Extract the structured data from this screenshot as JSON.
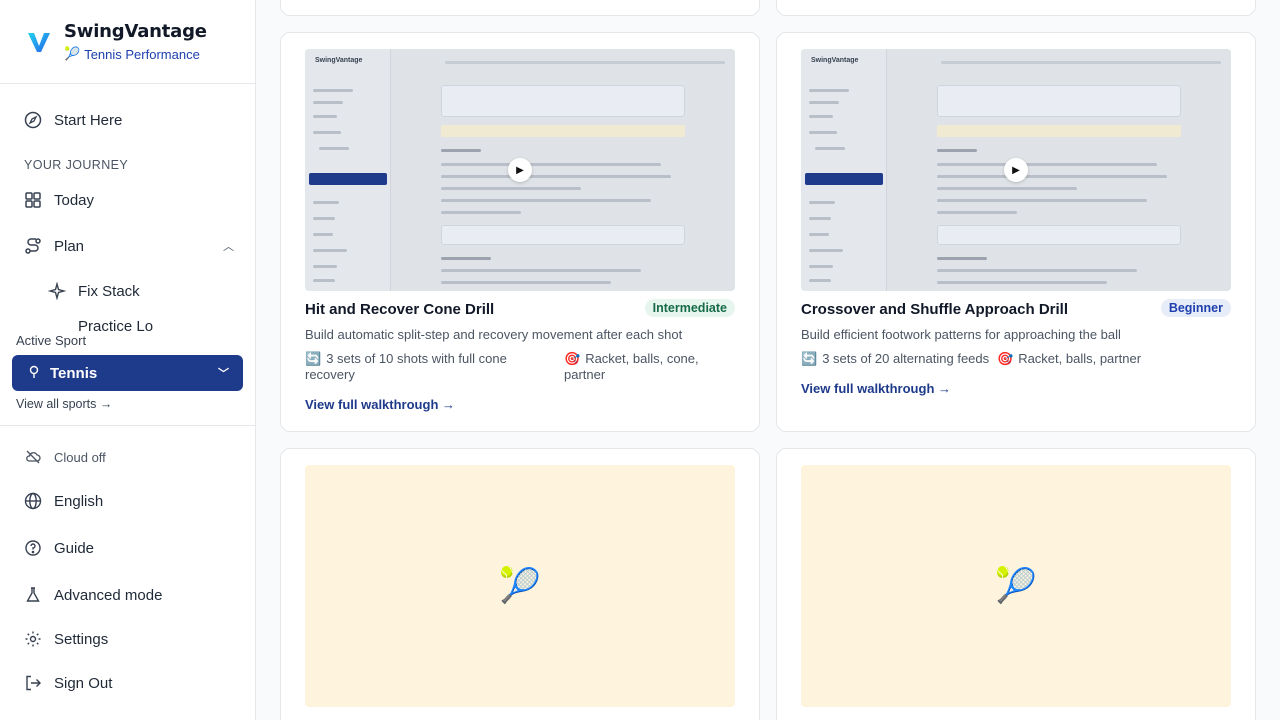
{
  "brand": {
    "name": "SwingVantage",
    "subtitle": "Tennis Performance",
    "subtitle_icon": "🎾"
  },
  "sidebar": {
    "start_here": "Start Here",
    "journey_label": "YOUR JOURNEY",
    "today": "Today",
    "plan": "Plan",
    "fix_stack": "Fix Stack",
    "practice_partial": "Practice Lo",
    "active_sport_label": "Active Sport",
    "sport": "Tennis",
    "view_all": "View all sports →",
    "cloud": "Cloud off",
    "language": "English",
    "guide": "Guide",
    "advanced": "Advanced mode",
    "settings": "Settings",
    "sign_out": "Sign Out"
  },
  "drills": [
    {
      "title": "Hit and Recover Cone Drill",
      "level": "Intermediate",
      "description": "Build automatic split-step and recovery movement after each shot",
      "sets_icon": "🔄",
      "sets": "3 sets of 10 shots with full cone recovery",
      "equip_icon": "🎯",
      "equipment": "Racket, balls, cone, partner",
      "link": "View full walkthrough →",
      "thumb_title": "SwingVantage"
    },
    {
      "title": "Crossover and Shuffle Approach Drill",
      "level": "Beginner",
      "description": "Build efficient footwork patterns for approaching the ball",
      "sets_icon": "🔄",
      "sets": "3 sets of 20 alternating feeds",
      "equip_icon": "🎯",
      "equipment": "Racket, balls, partner",
      "link": "View full walkthrough →",
      "thumb_title": "SwingVantage"
    },
    {
      "placeholder_icon": "🎾"
    },
    {
      "placeholder_icon": "🎾"
    }
  ],
  "colors": {
    "accent": "#1e3a8a",
    "intermediate_bg": "#e6f6ef",
    "beginner_bg": "#e7ecf9",
    "placeholder_bg": "#fef3dd"
  }
}
